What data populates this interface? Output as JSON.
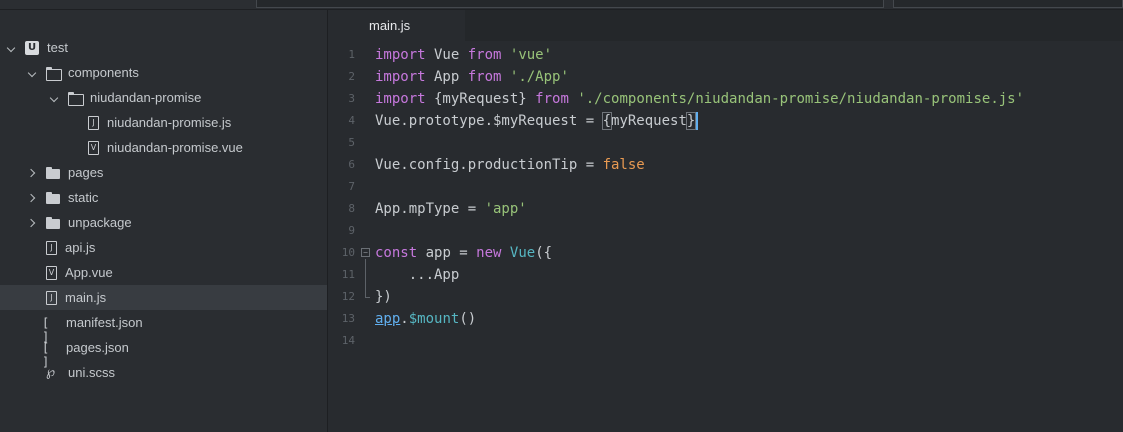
{
  "tree": {
    "project": {
      "name": "test"
    },
    "items": [
      {
        "label": "components"
      },
      {
        "label": "niudandan-promise"
      },
      {
        "label": "niudandan-promise.js",
        "glyph": "J"
      },
      {
        "label": "niudandan-promise.vue",
        "glyph": "V"
      },
      {
        "label": "pages"
      },
      {
        "label": "static"
      },
      {
        "label": "unpackage"
      },
      {
        "label": "api.js",
        "glyph": "J"
      },
      {
        "label": "App.vue",
        "glyph": "V"
      },
      {
        "label": "main.js",
        "glyph": "J",
        "selected": true
      },
      {
        "label": "manifest.json",
        "glyph": "[ ]"
      },
      {
        "label": "pages.json",
        "glyph": "[ ]"
      },
      {
        "label": "uni.scss",
        "glyph": "℘"
      }
    ]
  },
  "editor": {
    "tab": "main.js",
    "line_numbers": [
      "1",
      "2",
      "3",
      "4",
      "5",
      "6",
      "7",
      "8",
      "9",
      "10",
      "11",
      "12",
      "13",
      "14"
    ],
    "fold_marker": "−",
    "lines": [
      [
        {
          "t": "kw",
          "v": "import"
        },
        {
          "t": "p",
          "v": " Vue "
        },
        {
          "t": "kw",
          "v": "from"
        },
        {
          "t": "p",
          "v": " "
        },
        {
          "t": "str",
          "v": "'vue'"
        }
      ],
      [
        {
          "t": "kw",
          "v": "import"
        },
        {
          "t": "p",
          "v": " App "
        },
        {
          "t": "kw",
          "v": "from"
        },
        {
          "t": "p",
          "v": " "
        },
        {
          "t": "str",
          "v": "'./App'"
        }
      ],
      [
        {
          "t": "kw",
          "v": "import"
        },
        {
          "t": "p",
          "v": " {myRequest} "
        },
        {
          "t": "kw",
          "v": "from"
        },
        {
          "t": "p",
          "v": " "
        },
        {
          "t": "str",
          "v": "'./components/niudandan-promise/niudandan-promise.js'"
        }
      ],
      [
        {
          "t": "p",
          "v": "Vue.prototype.$myRequest = "
        },
        {
          "t": "hl",
          "v": "{"
        },
        {
          "t": "p",
          "v": "myRequest"
        },
        {
          "t": "hl",
          "v": "}"
        },
        {
          "t": "cursor",
          "v": ""
        }
      ],
      [],
      [
        {
          "t": "p",
          "v": "Vue.config.productionTip = "
        },
        {
          "t": "bool",
          "v": "false"
        }
      ],
      [],
      [
        {
          "t": "p",
          "v": "App.mpType = "
        },
        {
          "t": "str",
          "v": "'app'"
        }
      ],
      [],
      [
        {
          "t": "kw",
          "v": "const"
        },
        {
          "t": "p",
          "v": " app = "
        },
        {
          "t": "kw",
          "v": "new"
        },
        {
          "t": "p",
          "v": " "
        },
        {
          "t": "fn",
          "v": "Vue"
        },
        {
          "t": "p",
          "v": "({"
        }
      ],
      [
        {
          "t": "p",
          "v": "    ...App"
        }
      ],
      [
        {
          "t": "p",
          "v": "})"
        }
      ],
      [
        {
          "t": "obj",
          "v": "app"
        },
        {
          "t": "p",
          "v": "."
        },
        {
          "t": "fn",
          "v": "$mount"
        },
        {
          "t": "p",
          "v": "()"
        }
      ],
      []
    ]
  },
  "colors": {
    "keyword": "#c678dd",
    "string": "#98c379",
    "boolean": "#e89a52",
    "function": "#56b6c2",
    "cursor": "#61afef",
    "background": "#282b2f",
    "sidebar": "#2a2d31"
  },
  "icons": [
    "project-icon",
    "folder-icon",
    "folder-open-icon",
    "file-js-icon",
    "file-vue-icon",
    "json-icon",
    "scss-icon",
    "chevron-down-icon",
    "chevron-right-icon",
    "fold-icon"
  ]
}
